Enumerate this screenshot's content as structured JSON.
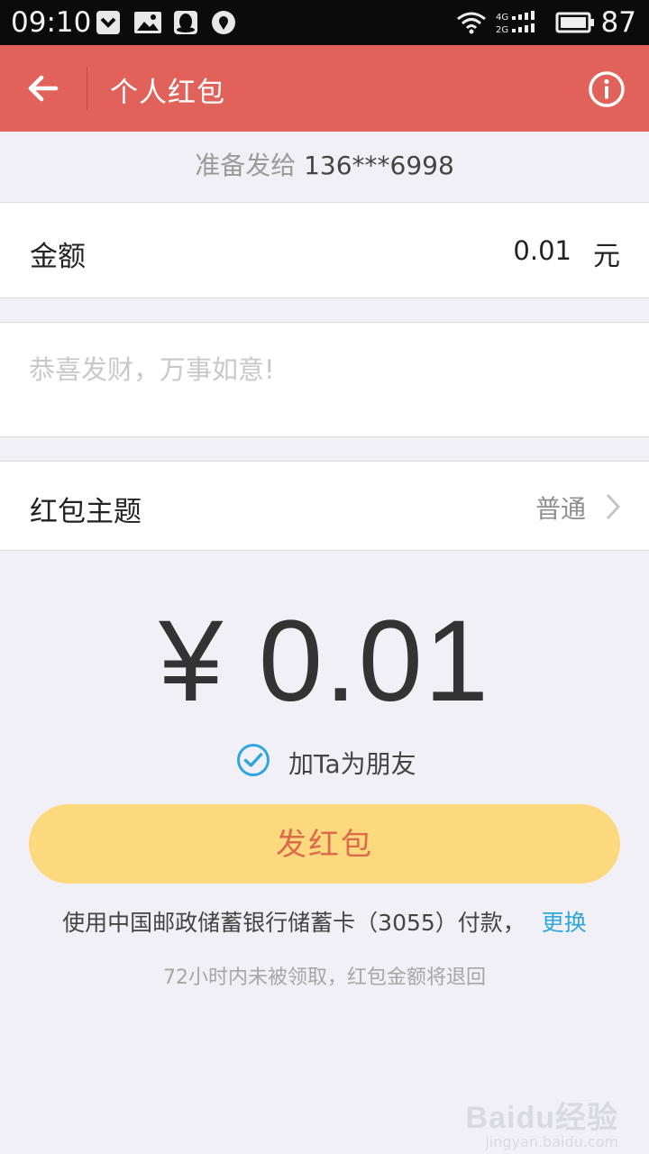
{
  "status_bar": {
    "time": "09:10",
    "battery": "87",
    "icons": [
      "download-box-icon",
      "image-icon",
      "qq-icon",
      "location-icon",
      "wifi-icon",
      "signal-4g-2g-icon",
      "battery-icon"
    ]
  },
  "header": {
    "title": "个人红包",
    "back_icon": "arrow-left-icon",
    "info_icon": "info-circle-icon"
  },
  "recipient": {
    "prefix": "准备发给",
    "phone": "136***6998"
  },
  "amount": {
    "label": "金额",
    "value": "0.01",
    "unit": "元"
  },
  "message": {
    "placeholder": "恭喜发财，万事如意!",
    "value": ""
  },
  "theme": {
    "label": "红包主题",
    "value": "普通"
  },
  "total": {
    "display": "¥ 0.01"
  },
  "add_friend": {
    "label": "加Ta为朋友",
    "checked": true
  },
  "send_button": {
    "label": "发红包"
  },
  "payment": {
    "text": "使用中国邮政储蓄银行储蓄卡（3055）付款，",
    "change_label": "更换"
  },
  "note": "72小时内未被领取，红包金额将退回",
  "watermark": {
    "logo": "Baidu经验",
    "url": "jingyan.baidu.com"
  },
  "colors": {
    "header": "#e0625a",
    "button": "#fbd97c",
    "button_text": "#de6a4e",
    "link": "#2fa6dc",
    "check": "#2fa6dc"
  }
}
